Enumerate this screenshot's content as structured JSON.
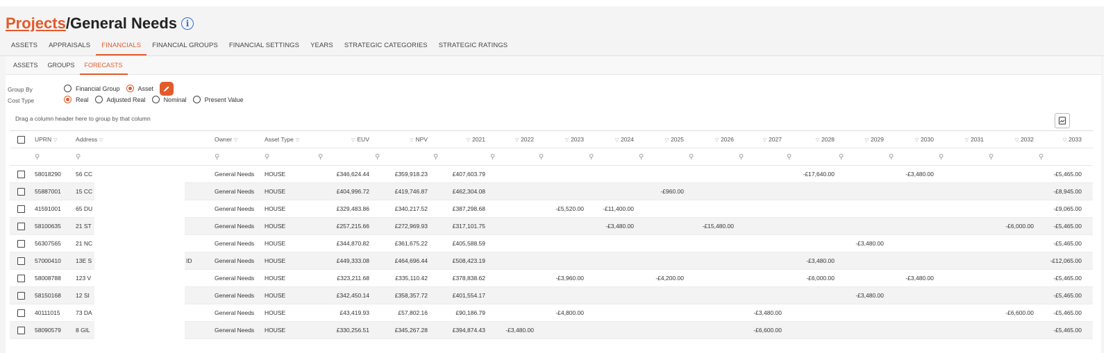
{
  "breadcrumb": {
    "projects": "Projects",
    "separator": "/",
    "current": "General Needs",
    "info_icon": "info-icon"
  },
  "main_tabs": [
    "ASSETS",
    "APPRAISALS",
    "FINANCIALS",
    "FINANCIAL GROUPS",
    "FINANCIAL SETTINGS",
    "YEARS",
    "STRATEGIC CATEGORIES",
    "STRATEGIC RATINGS"
  ],
  "main_tab_active": "FINANCIALS",
  "sub_tabs": [
    "ASSETS",
    "GROUPS",
    "FORECASTS"
  ],
  "sub_tab_active": "FORECASTS",
  "options": {
    "group_by_label": "Group By",
    "group_by": [
      {
        "label": "Financial Group",
        "checked": false
      },
      {
        "label": "Asset",
        "checked": true
      }
    ],
    "cost_type_label": "Cost Type",
    "cost_type": [
      {
        "label": "Real",
        "checked": true
      },
      {
        "label": "Adjusted Real",
        "checked": false
      },
      {
        "label": "Nominal",
        "checked": false
      },
      {
        "label": "Present Value",
        "checked": false
      }
    ],
    "edit_icon": "pencil-icon"
  },
  "drag_hint": "Drag a column header here to group by that column",
  "export_icon": "export-icon",
  "colors": {
    "accent": "#e35a2b",
    "info": "#2f6fd1",
    "row_alt": "#f3f3f3"
  },
  "grid": {
    "columns": [
      "UPRN",
      "Address",
      "Owner",
      "Asset Type",
      "EUV",
      "NPV",
      "2021",
      "2022",
      "2023",
      "2024",
      "2025",
      "2026",
      "2027",
      "2028",
      "2029",
      "2030",
      "2031",
      "2032",
      "2033"
    ],
    "rows": [
      {
        "uprn": "58018290",
        "address": "56 CC",
        "owner": "General Needs",
        "asset_type": "HOUSE",
        "euv": "£346,624.44",
        "npv": "£359,918.23",
        "y2021": "£407,603.79",
        "y2022": "",
        "y2023": "",
        "y2024": "",
        "y2025": "",
        "y2026": "",
        "y2027": "",
        "y2028": "-£17,640.00",
        "y2029": "",
        "y2030": "-£3,480.00",
        "y2031": "",
        "y2032": "",
        "y2033": "-£5,465.00"
      },
      {
        "uprn": "55887001",
        "address": "15 CC",
        "owner": "General Needs",
        "asset_type": "HOUSE",
        "euv": "£404,996.72",
        "npv": "£419,746.87",
        "y2021": "£462,304.08",
        "y2022": "",
        "y2023": "",
        "y2024": "",
        "y2025": "-£960.00",
        "y2026": "",
        "y2027": "",
        "y2028": "",
        "y2029": "",
        "y2030": "",
        "y2031": "",
        "y2032": "",
        "y2033": "-£8,945.00"
      },
      {
        "uprn": "41591001",
        "address": "65 DU",
        "owner": "General Needs",
        "asset_type": "HOUSE",
        "euv": "£329,483.86",
        "npv": "£340,217.52",
        "y2021": "£387,298.68",
        "y2022": "",
        "y2023": "-£5,520.00",
        "y2024": "-£11,400.00",
        "y2025": "",
        "y2026": "",
        "y2027": "",
        "y2028": "",
        "y2029": "",
        "y2030": "",
        "y2031": "",
        "y2032": "",
        "y2033": "-£9,065.00"
      },
      {
        "uprn": "58100635",
        "address": "21 ST",
        "owner": "General Needs",
        "asset_type": "HOUSE",
        "euv": "£257,215.66",
        "npv": "£272,969.93",
        "y2021": "£317,101.75",
        "y2022": "",
        "y2023": "",
        "y2024": "-£3,480.00",
        "y2025": "",
        "y2026": "-£15,480.00",
        "y2027": "",
        "y2028": "",
        "y2029": "",
        "y2030": "",
        "y2031": "",
        "y2032": "-£6,000.00",
        "y2033": "-£5,465.00"
      },
      {
        "uprn": "56307565",
        "address": "21 NC",
        "owner": "General Needs",
        "asset_type": "HOUSE",
        "euv": "£344,870.82",
        "npv": "£361,675.22",
        "y2021": "£405,588.59",
        "y2022": "",
        "y2023": "",
        "y2024": "",
        "y2025": "",
        "y2026": "",
        "y2027": "",
        "y2028": "",
        "y2029": "-£3,480.00",
        "y2030": "",
        "y2031": "",
        "y2032": "",
        "y2033": "-£5,465.00"
      },
      {
        "uprn": "57000410",
        "address": "13E S",
        "address_tail": "ID",
        "owner": "General Needs",
        "asset_type": "HOUSE",
        "euv": "£449,333.08",
        "npv": "£464,696.44",
        "y2021": "£508,423.19",
        "y2022": "",
        "y2023": "",
        "y2024": "",
        "y2025": "",
        "y2026": "",
        "y2027": "",
        "y2028": "-£3,480.00",
        "y2029": "",
        "y2030": "",
        "y2031": "",
        "y2032": "",
        "y2033": "-£12,065.00"
      },
      {
        "uprn": "58008788",
        "address": "123 V",
        "owner": "General Needs",
        "asset_type": "HOUSE",
        "euv": "£323,211.68",
        "npv": "£335,110.42",
        "y2021": "£378,838.62",
        "y2022": "",
        "y2023": "-£3,960.00",
        "y2024": "",
        "y2025": "-£4,200.00",
        "y2026": "",
        "y2027": "",
        "y2028": "-£6,000.00",
        "y2029": "",
        "y2030": "-£3,480.00",
        "y2031": "",
        "y2032": "",
        "y2033": "-£5,465.00"
      },
      {
        "uprn": "58150168",
        "address": "12 SI",
        "owner": "General Needs",
        "asset_type": "HOUSE",
        "euv": "£342,450.14",
        "npv": "£358,357.72",
        "y2021": "£401,554.17",
        "y2022": "",
        "y2023": "",
        "y2024": "",
        "y2025": "",
        "y2026": "",
        "y2027": "",
        "y2028": "",
        "y2029": "-£3,480.00",
        "y2030": "",
        "y2031": "",
        "y2032": "",
        "y2033": "-£5,465.00"
      },
      {
        "uprn": "40111015",
        "address": "73 DA",
        "owner": "General Needs",
        "asset_type": "HOUSE",
        "euv": "£43,419.93",
        "npv": "£57,802.16",
        "y2021": "£90,186.79",
        "y2022": "",
        "y2023": "-£4,800.00",
        "y2024": "",
        "y2025": "",
        "y2026": "",
        "y2027": "-£3,480.00",
        "y2028": "",
        "y2029": "",
        "y2030": "",
        "y2031": "",
        "y2032": "-£6,600.00",
        "y2033": "-£5,465.00"
      },
      {
        "uprn": "58090579",
        "address": "8 GIL",
        "owner": "General Needs",
        "asset_type": "HOUSE",
        "euv": "£330,256.51",
        "npv": "£345,267.28",
        "y2021": "£394,874.43",
        "y2022": "-£3,480.00",
        "y2023": "",
        "y2024": "",
        "y2025": "",
        "y2026": "",
        "y2027": "-£6,600.00",
        "y2028": "",
        "y2029": "",
        "y2030": "",
        "y2031": "",
        "y2032": "",
        "y2033": "-£5,465.00"
      }
    ]
  }
}
